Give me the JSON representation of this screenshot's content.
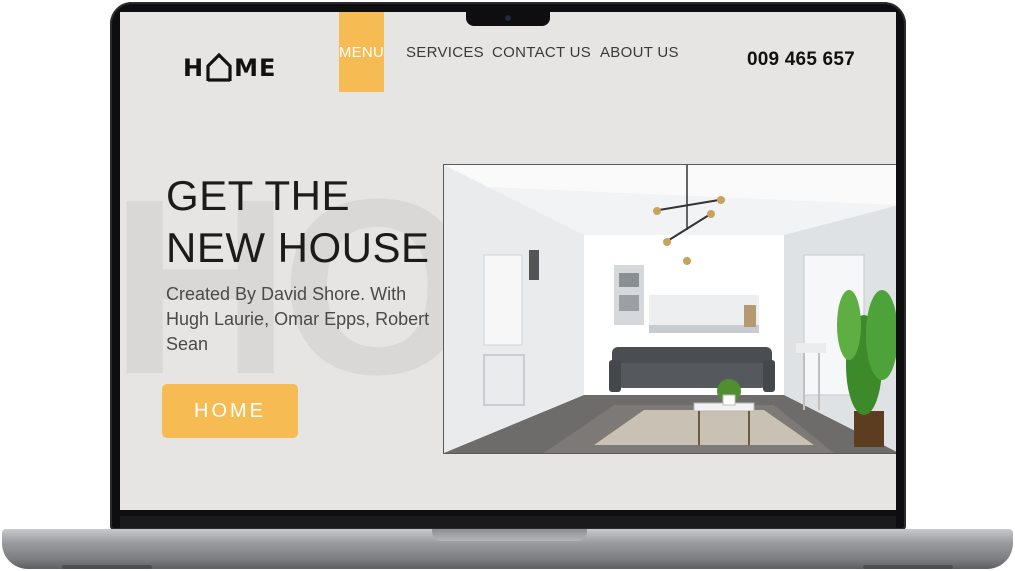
{
  "header": {
    "logo_prefix": "H",
    "logo_suffix": "ME",
    "nav": [
      {
        "label": "MENU",
        "active": true
      },
      {
        "label": "SERVICES"
      },
      {
        "label": "CONTACT US"
      },
      {
        "label": "ABOUT US"
      }
    ],
    "phone": "009 465 657"
  },
  "hero": {
    "background_text": "HO",
    "heading": "GET THE NEW HOUSE",
    "subtitle": "Created By David Shore. With Hugh Laurie, Omar Epps, Robert Sean",
    "button_label": "HOME",
    "image_icon": "living-room-photo"
  },
  "colors": {
    "accent": "#f6bb52",
    "screen_bg": "#e6e5e4",
    "text_dark": "#1b1b1b"
  }
}
